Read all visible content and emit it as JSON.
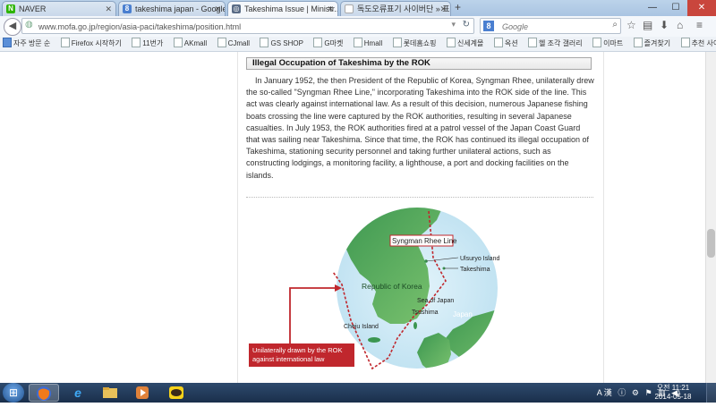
{
  "browser": {
    "tabs": [
      {
        "label": "NAVER",
        "icon": "naver-icon",
        "icon_color": "#2db400",
        "icon_text": "N"
      },
      {
        "label": "takeshima japan - Google ...",
        "icon": "google-icon",
        "icon_color": "#4a7fd0",
        "icon_text": "8"
      },
      {
        "label": "Takeshima Issue  |  Ministr...",
        "icon": "page-icon",
        "icon_color": "#5a6c86",
        "icon_text": "◎"
      },
      {
        "label": "독도오류표기 사이버단 » 표기...",
        "icon": "blank-icon",
        "icon_color": "#ffffff",
        "icon_text": ""
      }
    ],
    "active_tab_index": 2,
    "url": "www.mofa.go.jp/region/asia-paci/takeshima/position.html",
    "search_placeholder": "Google",
    "bookmarks": [
      "자주 방문 순",
      "Firefox 시작하기",
      "11번가",
      "AKmall",
      "CJmall",
      "GS SHOP",
      "G마켓",
      "Hmall",
      "롯데홈쇼핑",
      "신세계몰",
      "옥션",
      "헬 조각 갤러리",
      "이마트",
      "즐겨찾기",
      "추천 사이트"
    ]
  },
  "article": {
    "heading": "Illegal Occupation of Takeshima by the ROK",
    "body": "In January 1952, the then President of the Republic of Korea, Syngman Rhee, unilaterally drew the so-called \"Syngman Rhee Line,\" incorporating Takeshima into the ROK side of the line. This act was clearly against international law. As a result of this decision, numerous Japanese fishing boats crossing the line were captured by the ROK authorities, resulting in several Japanese casualties. In July 1953, the ROK authorities fired at a patrol vessel of the Japan Coast Guard that was sailing near Takeshima. Since that time, the ROK has continued its illegal occupation of Takeshima, stationing security personnel and taking further unilateral actions, such as constructing lodgings, a monitoring facility, a lighthouse, a port and docking facilities on the islands."
  },
  "map": {
    "labels": {
      "line": "Syngman Rhee Line",
      "ulsuryo": "Ulsuryo Island",
      "takeshima": "Takeshima",
      "korea": "Republic of Korea",
      "sea": "Sea of Japan",
      "japan": "Japan",
      "cheju": "Cheju Island",
      "tsushima": "Tsushima"
    },
    "callout_line1": "Unilaterally drawn by the ROK",
    "callout_line2": "against international law",
    "colors": {
      "sea": "#cfe9f5",
      "land": "#4aa860",
      "line": "#c0272d"
    }
  },
  "taskbar": {
    "apps": [
      "explorer-icon",
      "firefox-icon",
      "ie-icon",
      "folder-icon",
      "media-player-icon",
      "kakaotalk-icon"
    ],
    "tray": "A 漢",
    "time": "오전 11:21",
    "date": "2014-05-18"
  }
}
